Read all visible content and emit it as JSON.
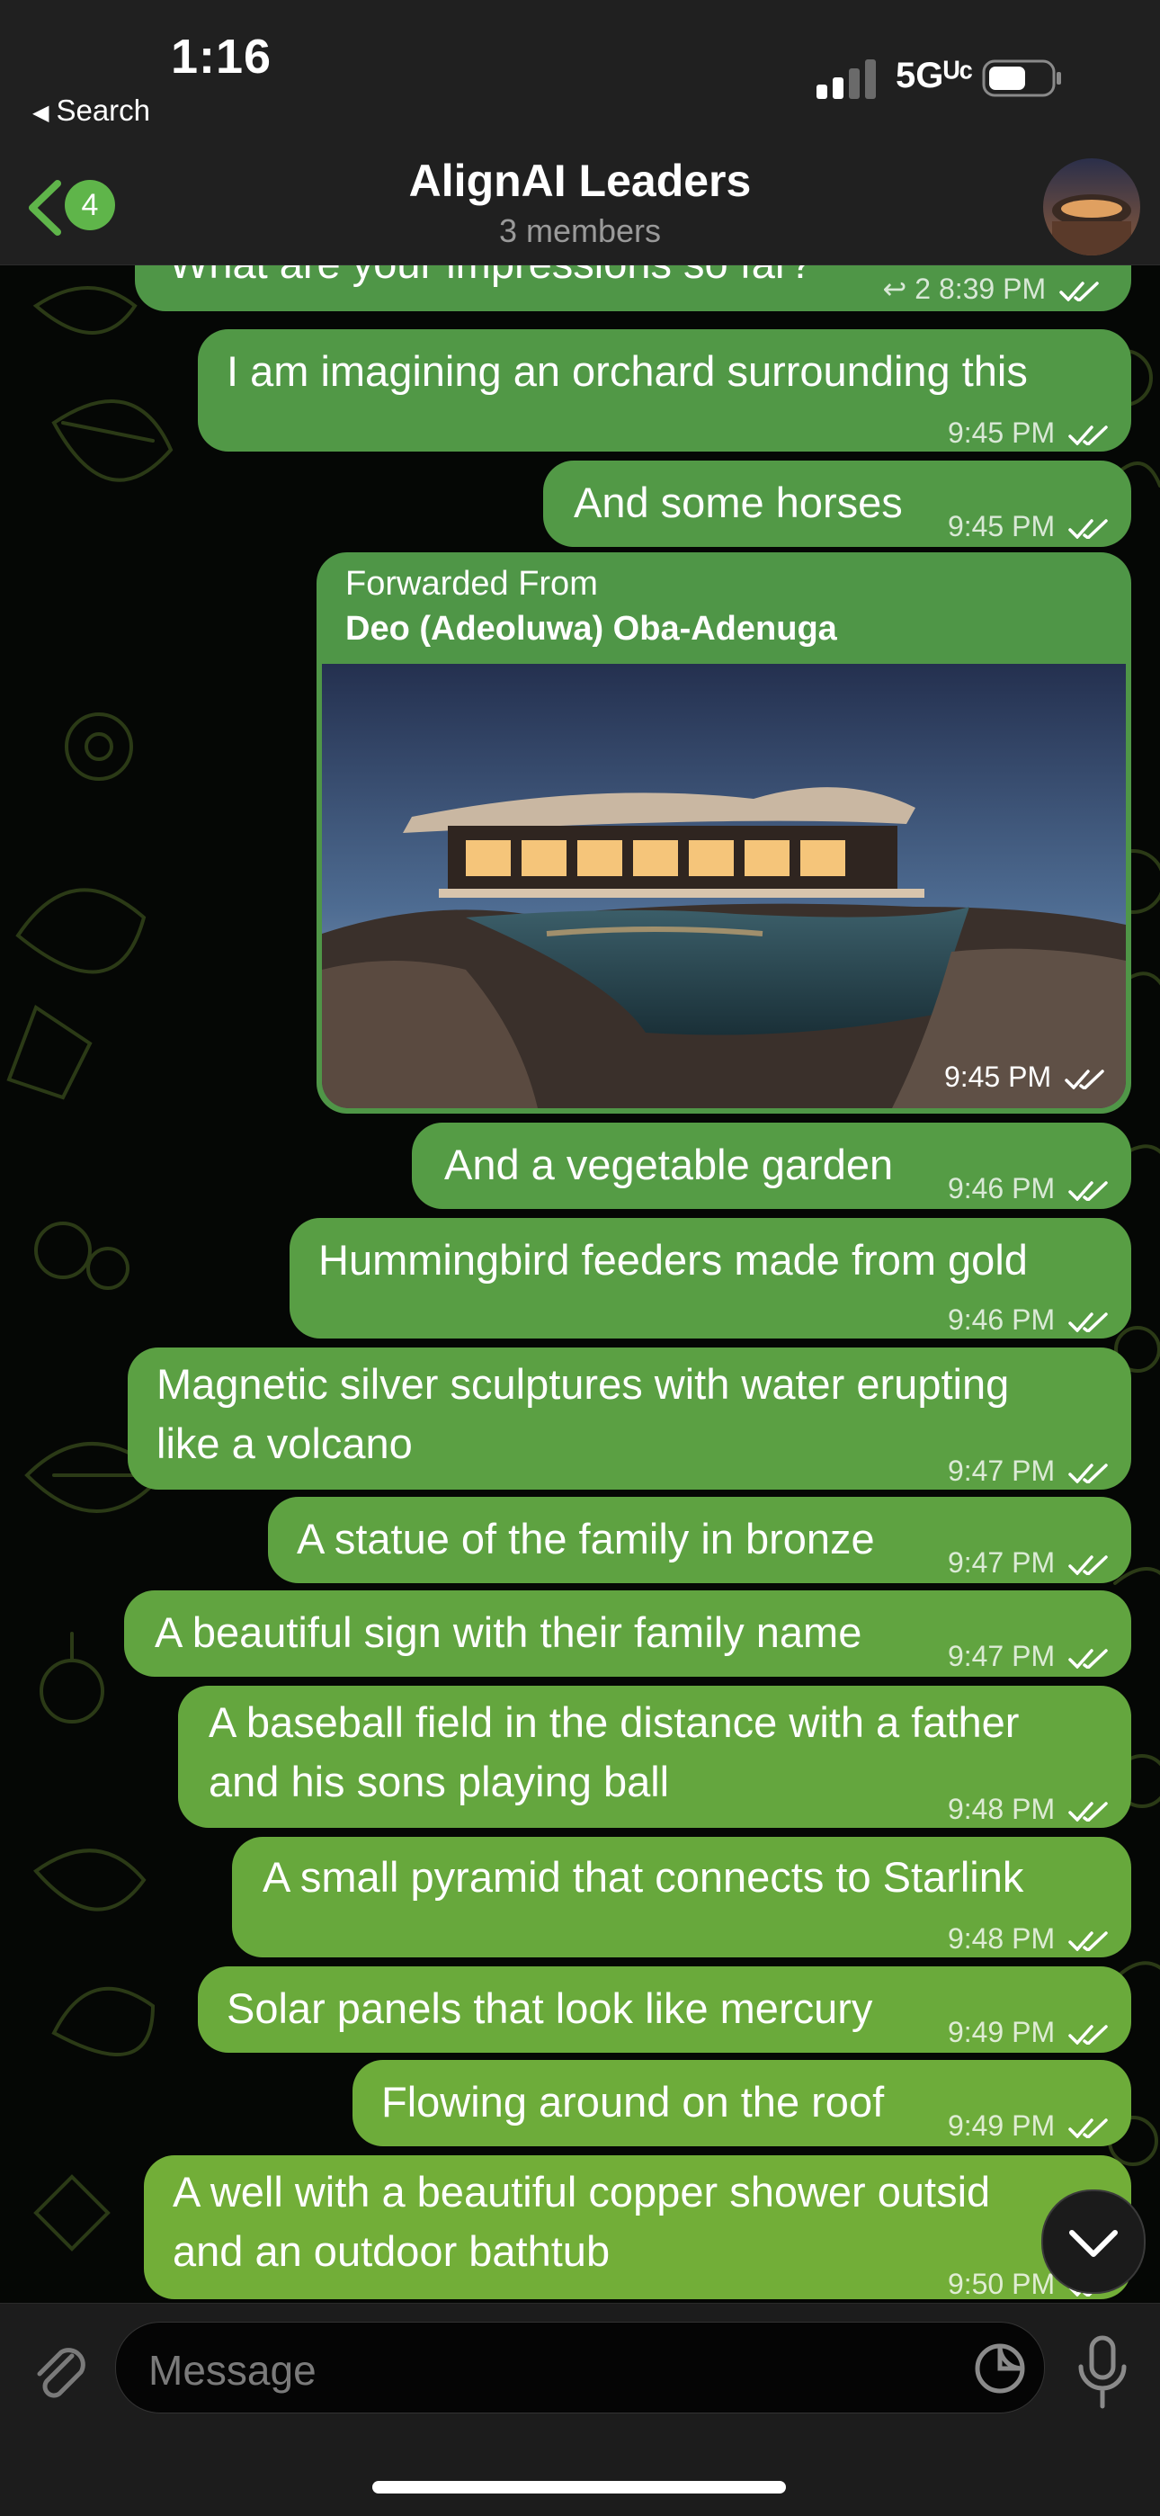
{
  "status_bar": {
    "time": "1:16",
    "back_app": "Search",
    "network": "5Gᵁᶜ"
  },
  "header": {
    "back_badge": "4",
    "title": "AlignAI Leaders",
    "subtitle": "3 members"
  },
  "messages": [
    {
      "text": "What are your impressions so far?",
      "replies": "2",
      "time": "8:39 PM"
    },
    {
      "text": "I am imagining an orchard surrounding this",
      "time": "9:45 PM"
    },
    {
      "text": "And some horses",
      "time": "9:45 PM"
    },
    {
      "forward_label": "Forwarded From",
      "forward_name": "Deo (Adeoluwa) Oba-Adenuga",
      "time": "9:45 PM"
    },
    {
      "text": "And a vegetable garden",
      "time": "9:46 PM"
    },
    {
      "text": "Hummingbird feeders made from gold",
      "time": "9:46 PM"
    },
    {
      "line1": "Magnetic silver sculptures with water erupting",
      "line2": "like a volcano",
      "time": "9:47 PM"
    },
    {
      "text": "A statue of the family in bronze",
      "time": "9:47 PM"
    },
    {
      "text": "A beautiful sign with their family name",
      "time": "9:47 PM"
    },
    {
      "line1": "A baseball field in the distance with a father",
      "line2": "and his sons playing ball",
      "time": "9:48 PM"
    },
    {
      "text": "A small pyramid that connects to Starlink",
      "time": "9:48 PM"
    },
    {
      "text": "Solar panels that look like mercury",
      "time": "9:49 PM"
    },
    {
      "text": "Flowing around on the roof",
      "time": "9:49 PM"
    },
    {
      "line1": "A well with a beautiful copper shower outsid",
      "line2": "and an outdoor bathtub",
      "time": "9:50 PM"
    }
  ],
  "input": {
    "placeholder": "Message"
  },
  "icons": {
    "back": "chevron-left-icon",
    "attach": "paperclip-icon",
    "sticker": "sticker-icon",
    "mic": "microphone-icon",
    "scroll": "chevron-down-icon",
    "ticks": "double-check-icon"
  },
  "colors": {
    "bubble_top": "#4f9647",
    "bubble_bottom": "#72a83a",
    "accent": "#5fb54a",
    "header_bg": "#202020"
  }
}
